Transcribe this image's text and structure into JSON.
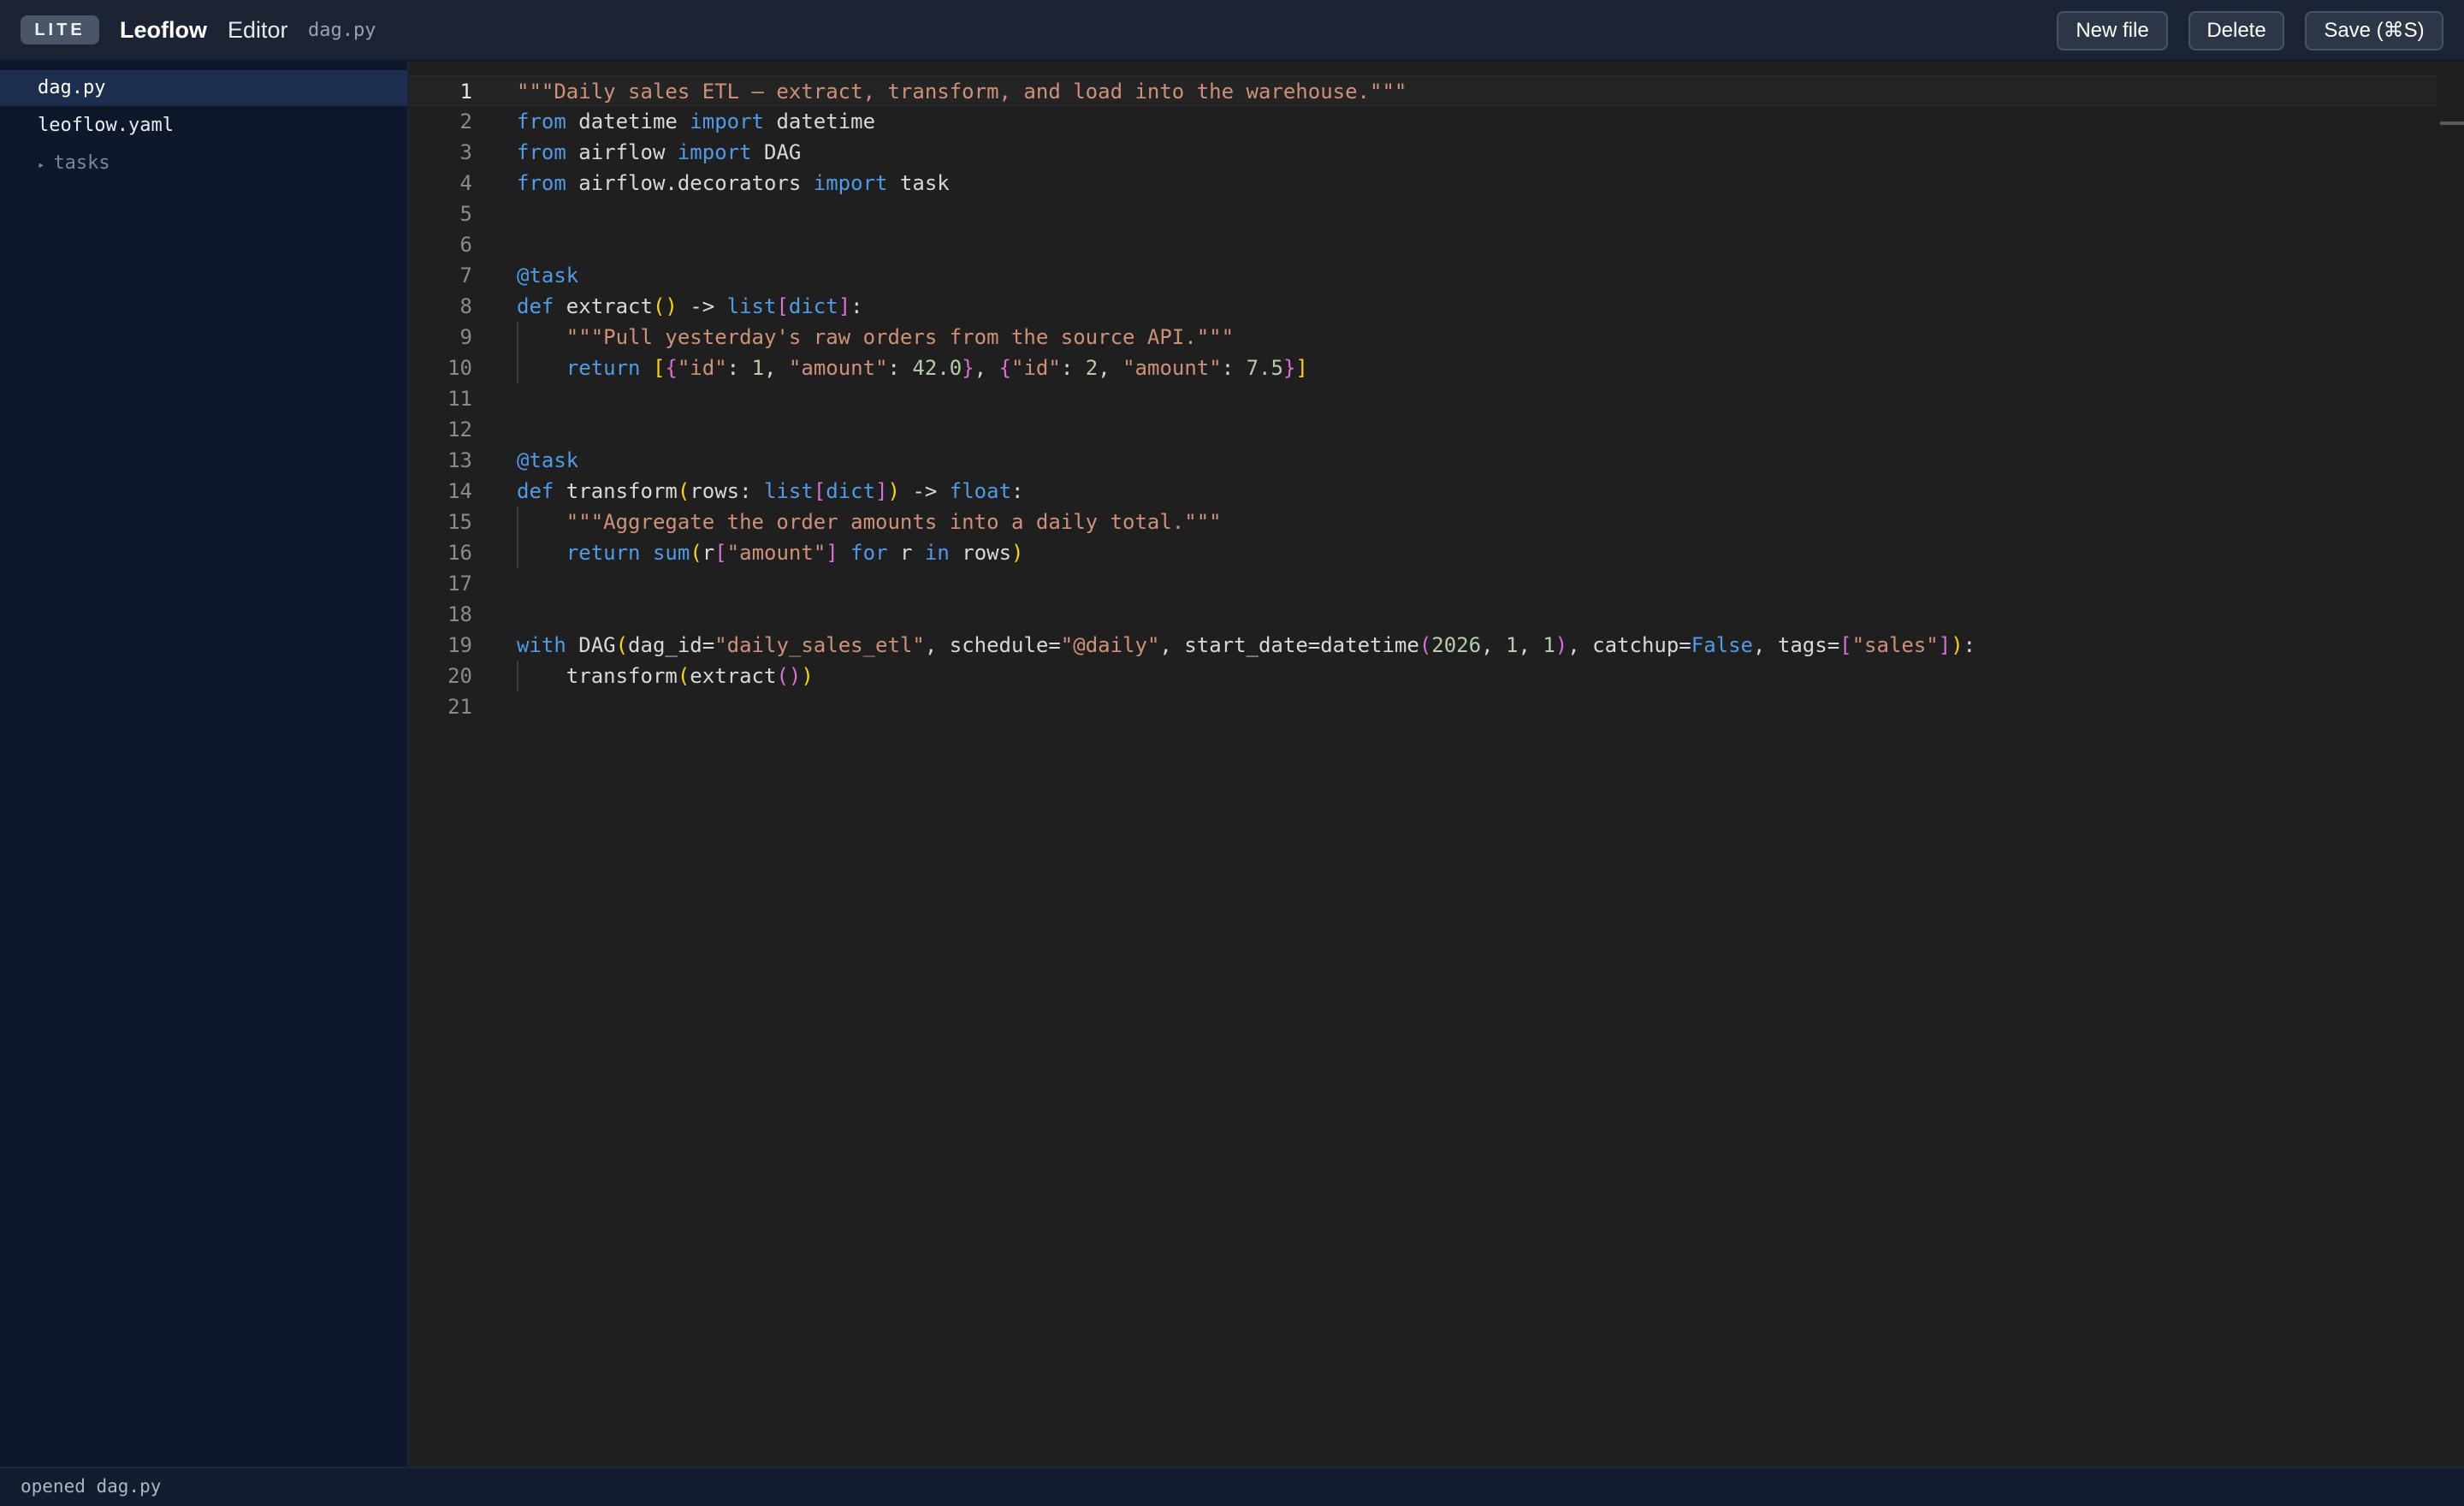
{
  "header": {
    "badge": "LITE",
    "brand": "Leoflow",
    "section": "Editor",
    "current_file": "dag.py",
    "buttons": {
      "new_file": "New file",
      "delete": "Delete",
      "save": "Save (⌘S)"
    }
  },
  "sidebar": {
    "items": [
      {
        "label": "dag.py",
        "active": true
      },
      {
        "label": "leoflow.yaml",
        "active": false
      }
    ],
    "folder": {
      "label": "tasks",
      "chevron": "▸"
    }
  },
  "editor": {
    "active_line": 1,
    "line_numbers": [
      "1",
      "2",
      "3",
      "4",
      "5",
      "6",
      "7",
      "8",
      "9",
      "10",
      "11",
      "12",
      "13",
      "14",
      "15",
      "16",
      "17",
      "18",
      "19",
      "20",
      "21"
    ],
    "lines": [
      [
        [
          "str",
          "\"\"\"Daily sales ETL — extract, transform, and load into the warehouse.\"\"\""
        ]
      ],
      [
        [
          "kw",
          "from"
        ],
        [
          "fn",
          " datetime "
        ],
        [
          "kw",
          "import"
        ],
        [
          "fn",
          " datetime"
        ]
      ],
      [
        [
          "kw",
          "from"
        ],
        [
          "fn",
          " airflow "
        ],
        [
          "kw",
          "import"
        ],
        [
          "fn",
          " DAG"
        ]
      ],
      [
        [
          "kw",
          "from"
        ],
        [
          "fn",
          " airflow.decorators "
        ],
        [
          "kw",
          "import"
        ],
        [
          "fn",
          " task"
        ]
      ],
      [],
      [],
      [
        [
          "kw",
          "@task"
        ]
      ],
      [
        [
          "kw",
          "def"
        ],
        [
          "fn",
          " extract"
        ],
        [
          "b1",
          "()"
        ],
        [
          "fn",
          " -> "
        ],
        [
          "kw",
          "list"
        ],
        [
          "b2",
          "["
        ],
        [
          "kw",
          "dict"
        ],
        [
          "b2",
          "]"
        ],
        [
          "fn",
          ":"
        ]
      ],
      [
        [
          "fn",
          "    "
        ],
        [
          "str",
          "\"\"\"Pull yesterday's raw orders from the source API.\"\"\""
        ]
      ],
      [
        [
          "fn",
          "    "
        ],
        [
          "kw",
          "return"
        ],
        [
          "fn",
          " "
        ],
        [
          "b1",
          "["
        ],
        [
          "b2",
          "{"
        ],
        [
          "str",
          "\"id\""
        ],
        [
          "fn",
          ": "
        ],
        [
          "num",
          "1"
        ],
        [
          "fn",
          ", "
        ],
        [
          "str",
          "\"amount\""
        ],
        [
          "fn",
          ": "
        ],
        [
          "num",
          "42.0"
        ],
        [
          "b2",
          "}"
        ],
        [
          "fn",
          ", "
        ],
        [
          "b2",
          "{"
        ],
        [
          "str",
          "\"id\""
        ],
        [
          "fn",
          ": "
        ],
        [
          "num",
          "2"
        ],
        [
          "fn",
          ", "
        ],
        [
          "str",
          "\"amount\""
        ],
        [
          "fn",
          ": "
        ],
        [
          "num",
          "7.5"
        ],
        [
          "b2",
          "}"
        ],
        [
          "b1",
          "]"
        ]
      ],
      [],
      [],
      [
        [
          "kw",
          "@task"
        ]
      ],
      [
        [
          "kw",
          "def"
        ],
        [
          "fn",
          " transform"
        ],
        [
          "b1",
          "("
        ],
        [
          "fn",
          "rows: "
        ],
        [
          "kw",
          "list"
        ],
        [
          "b2",
          "["
        ],
        [
          "kw",
          "dict"
        ],
        [
          "b2",
          "]"
        ],
        [
          "b1",
          ")"
        ],
        [
          "fn",
          " -> "
        ],
        [
          "kw",
          "float"
        ],
        [
          "fn",
          ":"
        ]
      ],
      [
        [
          "fn",
          "    "
        ],
        [
          "str",
          "\"\"\"Aggregate the order amounts into a daily total.\"\"\""
        ]
      ],
      [
        [
          "fn",
          "    "
        ],
        [
          "kw",
          "return"
        ],
        [
          "fn",
          " "
        ],
        [
          "kw",
          "sum"
        ],
        [
          "b1",
          "("
        ],
        [
          "fn",
          "r"
        ],
        [
          "b2",
          "["
        ],
        [
          "str",
          "\"amount\""
        ],
        [
          "b2",
          "]"
        ],
        [
          "fn",
          " "
        ],
        [
          "kw",
          "for"
        ],
        [
          "fn",
          " r "
        ],
        [
          "kw",
          "in"
        ],
        [
          "fn",
          " rows"
        ],
        [
          "b1",
          ")"
        ]
      ],
      [],
      [],
      [
        [
          "kw",
          "with"
        ],
        [
          "fn",
          " DAG"
        ],
        [
          "b1",
          "("
        ],
        [
          "fn",
          "dag_id="
        ],
        [
          "str",
          "\"daily_sales_etl\""
        ],
        [
          "fn",
          ", schedule="
        ],
        [
          "str",
          "\"@daily\""
        ],
        [
          "fn",
          ", start_date=datetime"
        ],
        [
          "b2",
          "("
        ],
        [
          "num",
          "2026"
        ],
        [
          "fn",
          ", "
        ],
        [
          "num",
          "1"
        ],
        [
          "fn",
          ", "
        ],
        [
          "num",
          "1"
        ],
        [
          "b2",
          ")"
        ],
        [
          "fn",
          ", catchup="
        ],
        [
          "kw",
          "False"
        ],
        [
          "fn",
          ", tags="
        ],
        [
          "b2",
          "["
        ],
        [
          "str",
          "\"sales\""
        ],
        [
          "b2",
          "]"
        ],
        [
          "b1",
          ")"
        ],
        [
          "fn",
          ":"
        ]
      ],
      [
        [
          "fn",
          "    transform"
        ],
        [
          "b1",
          "("
        ],
        [
          "fn",
          "extract"
        ],
        [
          "b2",
          "()"
        ],
        [
          "b1",
          ")"
        ]
      ],
      []
    ]
  },
  "status": {
    "message": "opened dag.py"
  }
}
